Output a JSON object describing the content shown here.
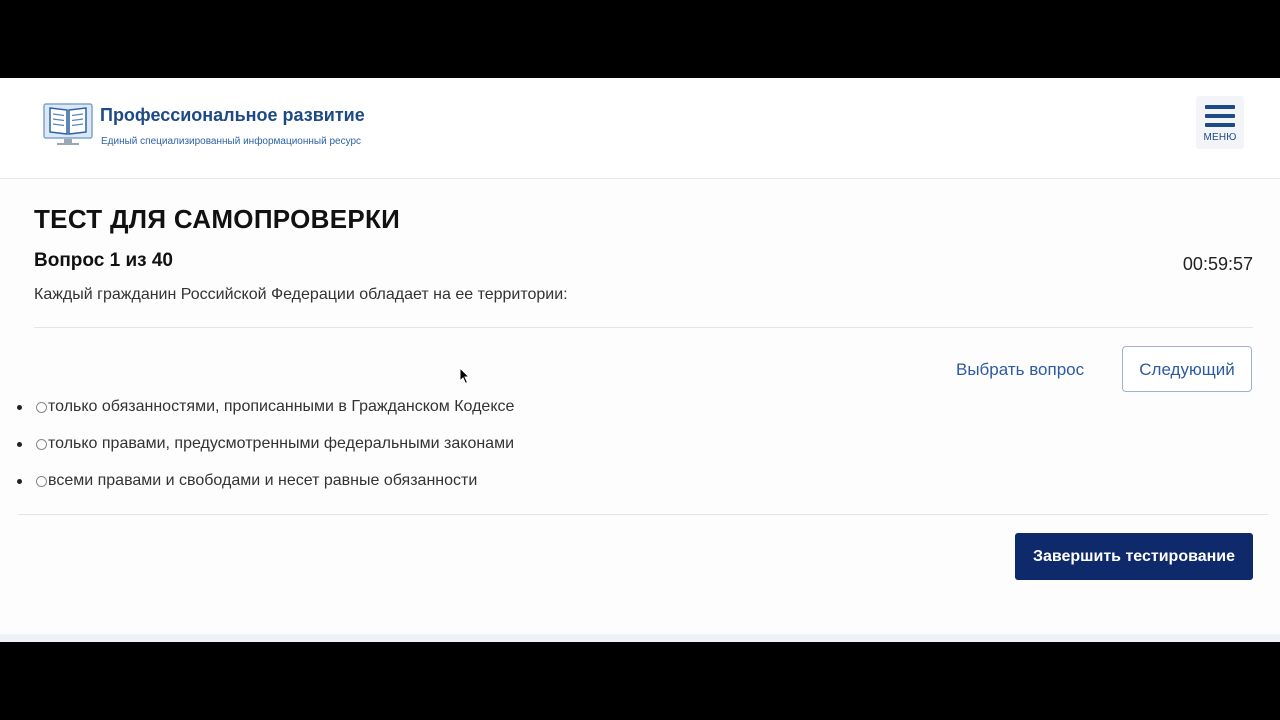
{
  "header": {
    "title": "Профессиональное развитие",
    "subtitle": "Единый специализированный информационный ресурс",
    "logo_icon": "open-book-monitor-icon",
    "menu_label": "МЕНЮ",
    "menu_icon": "hamburger-icon"
  },
  "test": {
    "title": "ТЕСТ ДЛЯ САМОПРОВЕРКИ",
    "question_number": "Вопрос 1 из 40",
    "timer": "00:59:57",
    "question_text": "Каждый гражданин Российской Федерации обладает на ее территории:",
    "choose_question_label": "Выбрать вопрос",
    "next_label": "Следующий",
    "options": [
      "только обязанностями, прописанными в Гражданском Кодексе",
      "только правами, предусмотренными федеральными законами",
      "всеми правами и свободами и несет равные обязанности"
    ],
    "finish_label": "Завершить тестирование"
  },
  "colors": {
    "brand": "#1d4a86",
    "link": "#2d5aa0",
    "primary_button": "#0e2a6b"
  }
}
